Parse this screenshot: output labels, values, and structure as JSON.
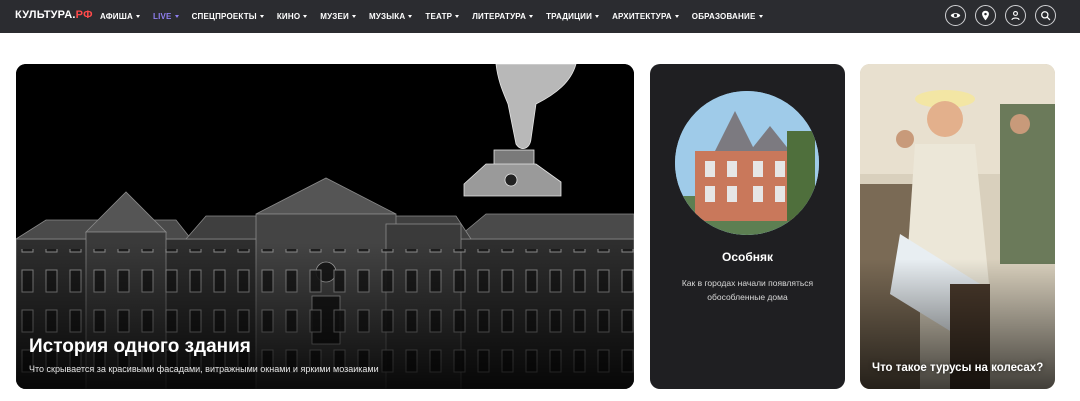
{
  "header": {
    "logo_main": "КУЛЬТУРА.",
    "logo_accent": "РФ",
    "nav": [
      {
        "label": "АФИША",
        "live": false
      },
      {
        "label": "LIVE",
        "live": true
      },
      {
        "label": "СПЕЦПРОЕКТЫ",
        "live": false
      },
      {
        "label": "КИНО",
        "live": false
      },
      {
        "label": "МУЗЕИ",
        "live": false
      },
      {
        "label": "МУЗЫКА",
        "live": false
      },
      {
        "label": "ТЕАТР",
        "live": false
      },
      {
        "label": "ЛИТЕРАТУРА",
        "live": false
      },
      {
        "label": "ТРАДИЦИИ",
        "live": false
      },
      {
        "label": "АРХИТЕКТУРА",
        "live": false
      },
      {
        "label": "ОБРАЗОВАНИЕ",
        "live": false
      }
    ],
    "icons": [
      "eye-icon",
      "location-pin-icon",
      "user-icon",
      "search-icon"
    ]
  },
  "cards": {
    "big": {
      "title": "История одного здания",
      "subtitle": "Что скрывается за красивыми фасадами, витражными окнами и яркими мозаиками"
    },
    "mid": {
      "title": "Особняк",
      "subtitle": "Как в городах начали появляться обособленные дома"
    },
    "right": {
      "title": "Что такое турусы на колесах?"
    }
  },
  "colors": {
    "header_bg": "#2b2c30",
    "logo_accent": "#ff4a4a",
    "live": "#8f7ff0",
    "mid_card_bg": "#1f1f22"
  }
}
